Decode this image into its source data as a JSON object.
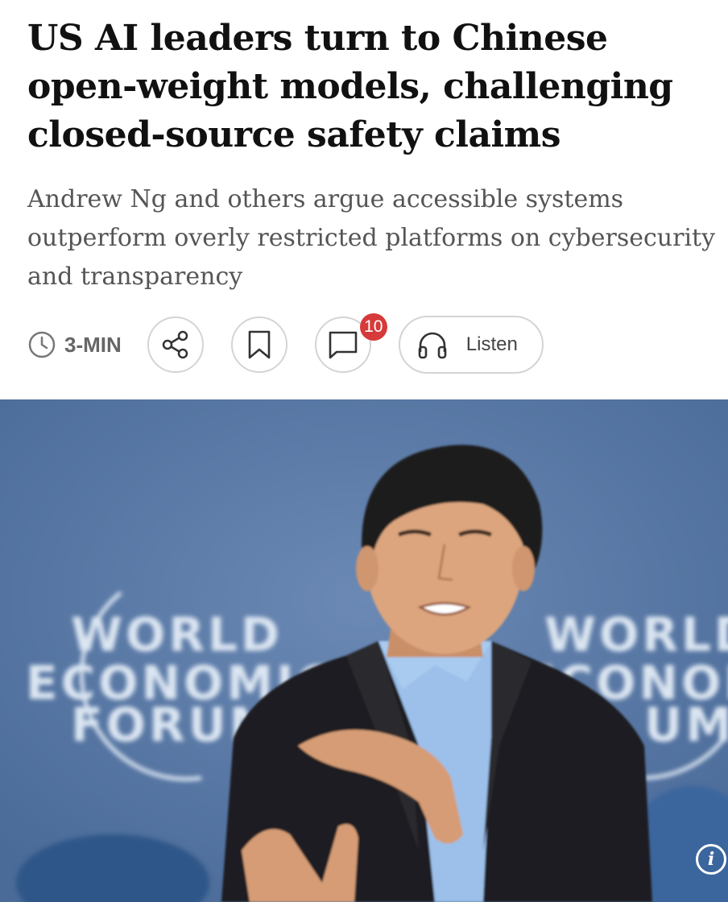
{
  "article": {
    "headline": "US AI leaders turn to Chinese open-weight models, challenging closed-source safety claims",
    "subheadline": "Andrew Ng and others argue accessible systems outperform overly restricted platforms on cybersecurity and transparency"
  },
  "toolbar": {
    "read_time": "3-MIN",
    "comment_count": "10",
    "listen_label": "Listen",
    "icons": [
      "clock-icon",
      "share-icon",
      "bookmark-icon",
      "comment-icon",
      "headphones-icon"
    ]
  },
  "photo": {
    "backdrop_text_left": [
      "WORLD",
      "ECONOMIC",
      "FORUM"
    ],
    "backdrop_text_right": [
      "WORLD",
      "ECONOM",
      "UM"
    ],
    "info_label": "i",
    "colors": {
      "backdrop": "#5f7fab",
      "jacket": "#1c1c1e",
      "shirt": "#9fc3ec",
      "skin": "#d9a27a"
    }
  }
}
